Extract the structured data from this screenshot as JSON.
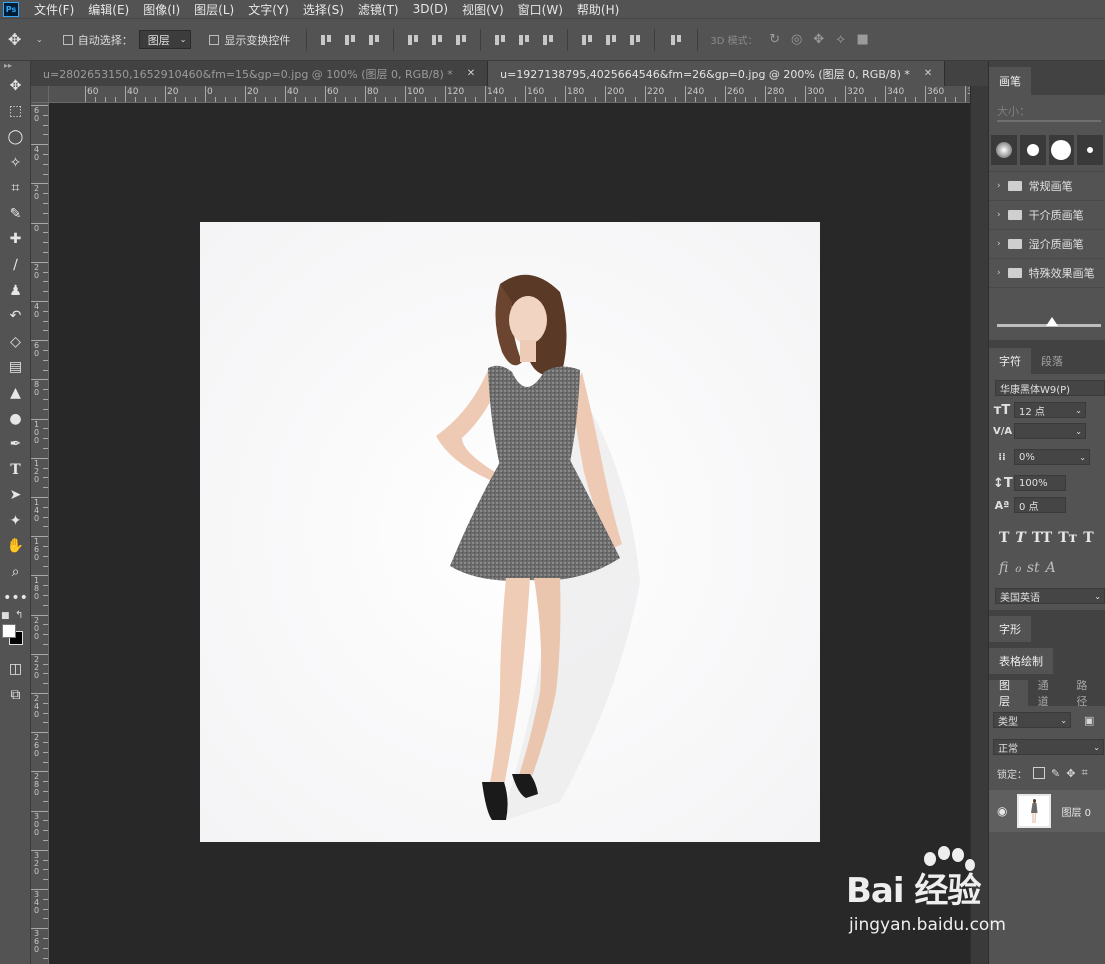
{
  "app": {
    "logo": "Ps"
  },
  "menu": [
    "文件(F)",
    "编辑(E)",
    "图像(I)",
    "图层(L)",
    "文字(Y)",
    "选择(S)",
    "滤镜(T)",
    "3D(D)",
    "视图(V)",
    "窗口(W)",
    "帮助(H)"
  ],
  "options": {
    "auto_select_label": "自动选择：",
    "auto_select_value": "图层",
    "show_transform_label": "显示变换控件",
    "mode_3d_label": "3D 模式："
  },
  "tools": [
    "move-tool",
    "marquee-tool",
    "lasso-tool",
    "magic-wand-tool",
    "crop-tool",
    "eyedropper-tool",
    "healing-brush-tool",
    "brush-tool",
    "clone-stamp-tool",
    "history-brush-tool",
    "eraser-tool",
    "gradient-tool",
    "blur-tool",
    "dodge-tool",
    "pen-tool",
    "type-tool",
    "path-selection-tool",
    "shape-tool",
    "hand-tool",
    "zoom-tool",
    "more-tools"
  ],
  "colors": {
    "foreground": "#ffffff",
    "background": "#000000",
    "ps_blue": "#31a8ff"
  },
  "tabs": [
    {
      "title": "u=2802653150,1652910460&fm=15&gp=0.jpg @ 100% (图层 0, RGB/8) *",
      "active": false
    },
    {
      "title": "u=1927138795,4025664546&fm=26&gp=0.jpg @ 200% (图层 0, RGB/8) *",
      "active": true
    }
  ],
  "ruler": {
    "h_labels": [
      "60",
      "40",
      "20",
      "0",
      "20",
      "40",
      "60",
      "80",
      "100",
      "120",
      "140",
      "160",
      "180",
      "200",
      "220",
      "240",
      "260",
      "280",
      "300",
      "320",
      "340",
      "360",
      "38"
    ],
    "v_labels": [
      "6 0",
      "4 0",
      "2 0",
      "0",
      "2 0",
      "4 0",
      "6 0",
      "8 0",
      "1 0 0",
      "1 2 0",
      "1 4 0",
      "1 6 0",
      "1 8 0",
      "2 0 0",
      "2 2 0",
      "2 4 0",
      "2 6 0",
      "2 8 0",
      "3 0 0",
      "3 2 0",
      "3 4 0",
      "3 6 0"
    ]
  },
  "brush_panel": {
    "tab": "画笔",
    "size_label": "大小：",
    "folders": [
      "常规画笔",
      "干介质画笔",
      "湿介质画笔",
      "特殊效果画笔"
    ]
  },
  "character_panel": {
    "tabs": [
      "字符",
      "段落"
    ],
    "font": "华康黑体W9(P)",
    "size": "12 点",
    "tracking": "0%",
    "vscale": "100%",
    "baseline": "0 点",
    "styles": [
      "T",
      "T",
      "TT",
      "Tт",
      "T"
    ],
    "opentype": [
      "fi",
      "ℴ",
      "st",
      "A"
    ],
    "language": "美国英语"
  },
  "glyph_panel": {
    "tab": "字形"
  },
  "table_panel": {
    "tab": "表格绘制"
  },
  "layers_panel": {
    "tabs": [
      "图层",
      "通道",
      "路径"
    ],
    "filter": "类型",
    "blend": "正常",
    "lock_label": "锁定：",
    "layer_name": "图层 0"
  },
  "watermark": {
    "brand": "Bai 经验",
    "url": "jingyan.baidu.com"
  }
}
